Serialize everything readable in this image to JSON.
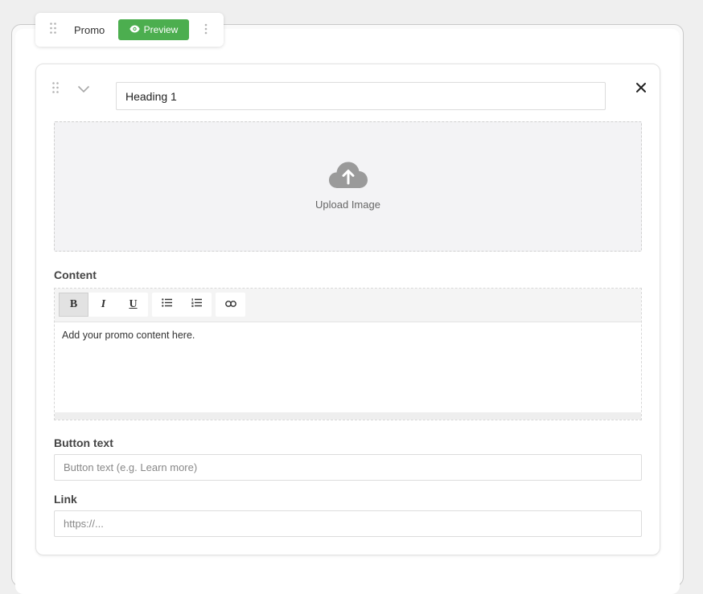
{
  "toolbar_tab": {
    "label": "Promo",
    "preview_label": "Preview",
    "icons": [
      "drag-handle-icon",
      "eye-icon",
      "kebab-menu-icon"
    ]
  },
  "block": {
    "heading_value": "Heading 1",
    "upload_label": "Upload Image",
    "content_label": "Content",
    "editor_text": "Add your promo content here.",
    "editor_buttons": [
      {
        "name": "bold",
        "label": "B"
      },
      {
        "name": "italic",
        "label": "I"
      },
      {
        "name": "underline",
        "label": "U"
      }
    ],
    "button_text_label": "Button text",
    "button_text_placeholder": "Button text (e.g. Learn more)",
    "link_label": "Link",
    "link_placeholder": "https://..."
  },
  "colors": {
    "accent_green": "#4cae4f",
    "upload_bg": "#f3f3f5"
  }
}
